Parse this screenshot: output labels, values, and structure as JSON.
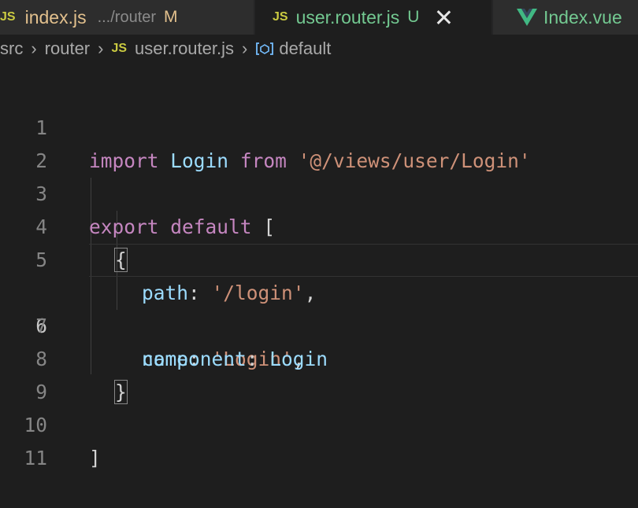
{
  "tabs": [
    {
      "icon": "JS",
      "name": "index.js",
      "dir": ".../router",
      "status": "M"
    },
    {
      "icon": "JS",
      "name": "user.router.js",
      "status": "U"
    },
    {
      "icon": "vue-icon",
      "name": "Index.vue"
    }
  ],
  "breadcrumb": {
    "items": [
      "src",
      "router",
      "user.router.js",
      "default"
    ]
  },
  "colors": {
    "keyword": "#c586c0",
    "identifier": "#9cdcfe",
    "string": "#ce9178",
    "modified": "#e2c08d",
    "untracked": "#73c991",
    "js_icon": "#cbcb41"
  },
  "code": {
    "l1": {
      "n": "1",
      "t": [
        "import",
        " ",
        "Login",
        " ",
        "from",
        " ",
        "'@/views/user/Login'"
      ]
    },
    "l2": {
      "n": "2"
    },
    "l3": {
      "n": "3",
      "t": [
        "export",
        " ",
        "default",
        " ",
        "["
      ]
    },
    "l4": {
      "n": "4",
      "t": [
        "{"
      ]
    },
    "l5": {
      "n": "5",
      "t": [
        "path",
        ":",
        " ",
        "'/login'",
        ","
      ]
    },
    "l6": {
      "n": "6",
      "t": [
        "name",
        ":",
        " ",
        "'Login'",
        ","
      ]
    },
    "l7": {
      "n": "7",
      "t": [
        "component",
        ":",
        " ",
        "Login"
      ]
    },
    "l8": {
      "n": "8",
      "t": [
        "}"
      ]
    },
    "l9": {
      "n": "9"
    },
    "l10": {
      "n": "10",
      "t": [
        "]"
      ]
    },
    "l11": {
      "n": "11"
    }
  }
}
